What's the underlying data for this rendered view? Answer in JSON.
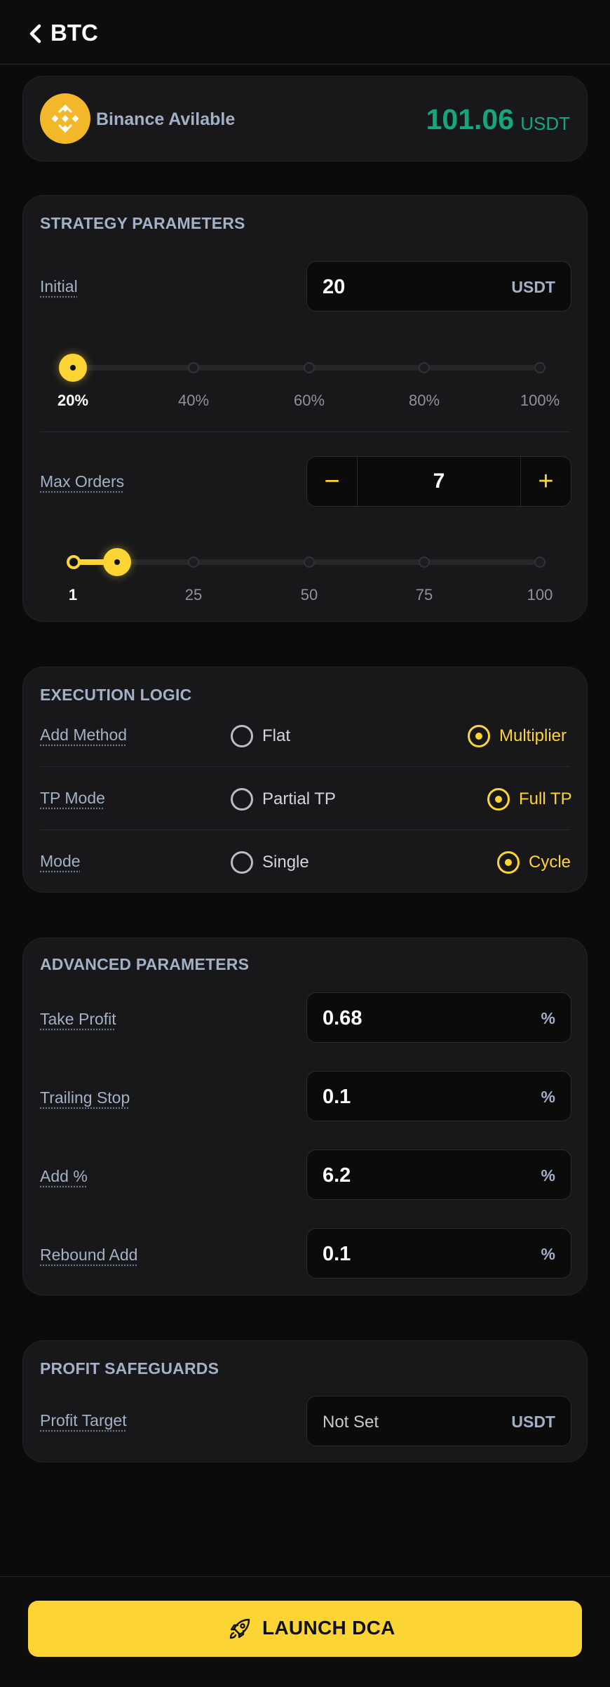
{
  "header": {
    "title": "BTC",
    "back_icon": "chevron-left-icon"
  },
  "balance": {
    "exchange_icon": "binance-logo-icon",
    "label": "Binance Avilable",
    "amount": "101.06",
    "unit": "USDT"
  },
  "strategy": {
    "title": "STRATEGY PARAMETERS",
    "initial": {
      "label": "Initial",
      "value": "20",
      "unit": "USDT"
    },
    "initial_slider": {
      "labels": [
        "20%",
        "40%",
        "60%",
        "80%",
        "100%"
      ],
      "selected": "20%"
    },
    "max_orders": {
      "label": "Max Orders",
      "value": "7",
      "minus": "−",
      "plus": "+"
    },
    "orders_slider": {
      "labels": [
        "1",
        "25",
        "50",
        "75",
        "100"
      ],
      "value": 7,
      "min": 1,
      "max": 100
    }
  },
  "execution": {
    "title": "EXECUTION LOGIC",
    "rows": [
      {
        "label": "Add Method",
        "options": [
          "Flat",
          "Multiplier"
        ],
        "selected": "Multiplier"
      },
      {
        "label": "TP Mode",
        "options": [
          "Partial TP",
          "Full TP"
        ],
        "selected": "Full TP"
      },
      {
        "label": "Mode",
        "options": [
          "Single",
          "Cycle"
        ],
        "selected": "Cycle"
      }
    ]
  },
  "advanced": {
    "title": "ADVANCED PARAMETERS",
    "fields": [
      {
        "label": "Take Profit",
        "value": "0.68",
        "unit": "%"
      },
      {
        "label": "Trailing Stop",
        "value": "0.1",
        "unit": "%"
      },
      {
        "label": "Add %",
        "value": "6.2",
        "unit": "%"
      },
      {
        "label": "Rebound Add",
        "value": "0.1",
        "unit": "%"
      }
    ]
  },
  "safeguards": {
    "title": "PROFIT SAFEGUARDS",
    "profit_target": {
      "label": "Profit Target",
      "placeholder": "Not Set",
      "unit": "USDT"
    }
  },
  "footer": {
    "launch_label": "LAUNCH DCA",
    "launch_icon": "rocket-icon"
  },
  "colors": {
    "accent": "#fcd535",
    "positive": "#17a67a",
    "background": "#0b0b0c",
    "card": "#18181a",
    "label": "#a3b1c7"
  }
}
